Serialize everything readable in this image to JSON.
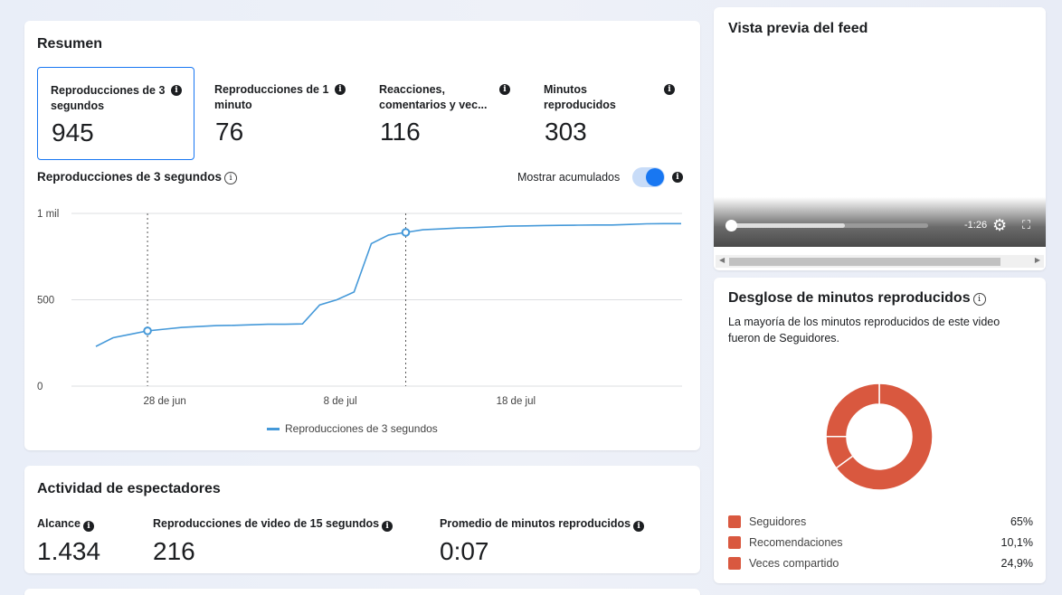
{
  "summary": {
    "title": "Resumen",
    "metrics": [
      {
        "label": "Reproducciones de 3 segundos",
        "value": "945"
      },
      {
        "label": "Reproducciones de 1 minuto",
        "value": "76"
      },
      {
        "label": "Reacciones, comentarios y vec...",
        "value": "116"
      },
      {
        "label": "Minutos reproducidos",
        "value": "303"
      }
    ],
    "chart_title": "Reproducciones de 3 segundos",
    "toggle_label": "Mostrar acumulados",
    "toggle_on": true
  },
  "chart_data": {
    "type": "line",
    "y_ticks": [
      "1 mil",
      "500",
      "0"
    ],
    "x_ticks": [
      "28 de jun",
      "8 de jul",
      "18 de jul"
    ],
    "ylim": [
      0,
      1000
    ],
    "series": [
      {
        "name": "Reproducciones de 3 segundos",
        "color": "#4599d9",
        "points": [
          {
            "day": 0,
            "value": 230
          },
          {
            "day": 1,
            "value": 280
          },
          {
            "day": 2,
            "value": 300
          },
          {
            "day": 3,
            "value": 320
          },
          {
            "day": 4,
            "value": 330
          },
          {
            "day": 5,
            "value": 340
          },
          {
            "day": 6,
            "value": 345
          },
          {
            "day": 7,
            "value": 350
          },
          {
            "day": 8,
            "value": 352
          },
          {
            "day": 9,
            "value": 355
          },
          {
            "day": 10,
            "value": 358
          },
          {
            "day": 11,
            "value": 358
          },
          {
            "day": 12,
            "value": 360
          },
          {
            "day": 13,
            "value": 470
          },
          {
            "day": 14,
            "value": 500
          },
          {
            "day": 15,
            "value": 545
          },
          {
            "day": 16,
            "value": 825
          },
          {
            "day": 17,
            "value": 875
          },
          {
            "day": 18,
            "value": 890
          },
          {
            "day": 19,
            "value": 905
          },
          {
            "day": 20,
            "value": 910
          },
          {
            "day": 21,
            "value": 915
          },
          {
            "day": 22,
            "value": 918
          },
          {
            "day": 23,
            "value": 922
          },
          {
            "day": 24,
            "value": 926
          },
          {
            "day": 25,
            "value": 928
          },
          {
            "day": 26,
            "value": 930
          },
          {
            "day": 27,
            "value": 931
          },
          {
            "day": 28,
            "value": 932
          },
          {
            "day": 29,
            "value": 933
          },
          {
            "day": 30,
            "value": 933
          },
          {
            "day": 31,
            "value": 936
          },
          {
            "day": 32,
            "value": 940
          },
          {
            "day": 33,
            "value": 941
          },
          {
            "day": 34,
            "value": 941
          }
        ]
      }
    ],
    "markers_at_day": [
      3,
      18
    ]
  },
  "activity": {
    "title": "Actividad de espectadores",
    "metrics": [
      {
        "label": "Alcance",
        "value": "1.434"
      },
      {
        "label": "Reproducciones de video de 15 segundos",
        "value": "216"
      },
      {
        "label": "Promedio de minutos reproducidos",
        "value": "0:07"
      }
    ]
  },
  "preview": {
    "title": "Vista previa del feed",
    "time_remaining": "-1:26",
    "progress": 0.58
  },
  "breakdown": {
    "title": "Desglose de minutos reproducidos",
    "description": "La mayoría de los minutos reproducidos de este video fueron de Seguidores.",
    "color": "#d9583f",
    "items": [
      {
        "label": "Seguidores",
        "pct": "65%",
        "value": 65
      },
      {
        "label": "Recomendaciones",
        "pct": "10,1%",
        "value": 10.1
      },
      {
        "label": "Veces compartido",
        "pct": "24,9%",
        "value": 24.9
      }
    ]
  }
}
